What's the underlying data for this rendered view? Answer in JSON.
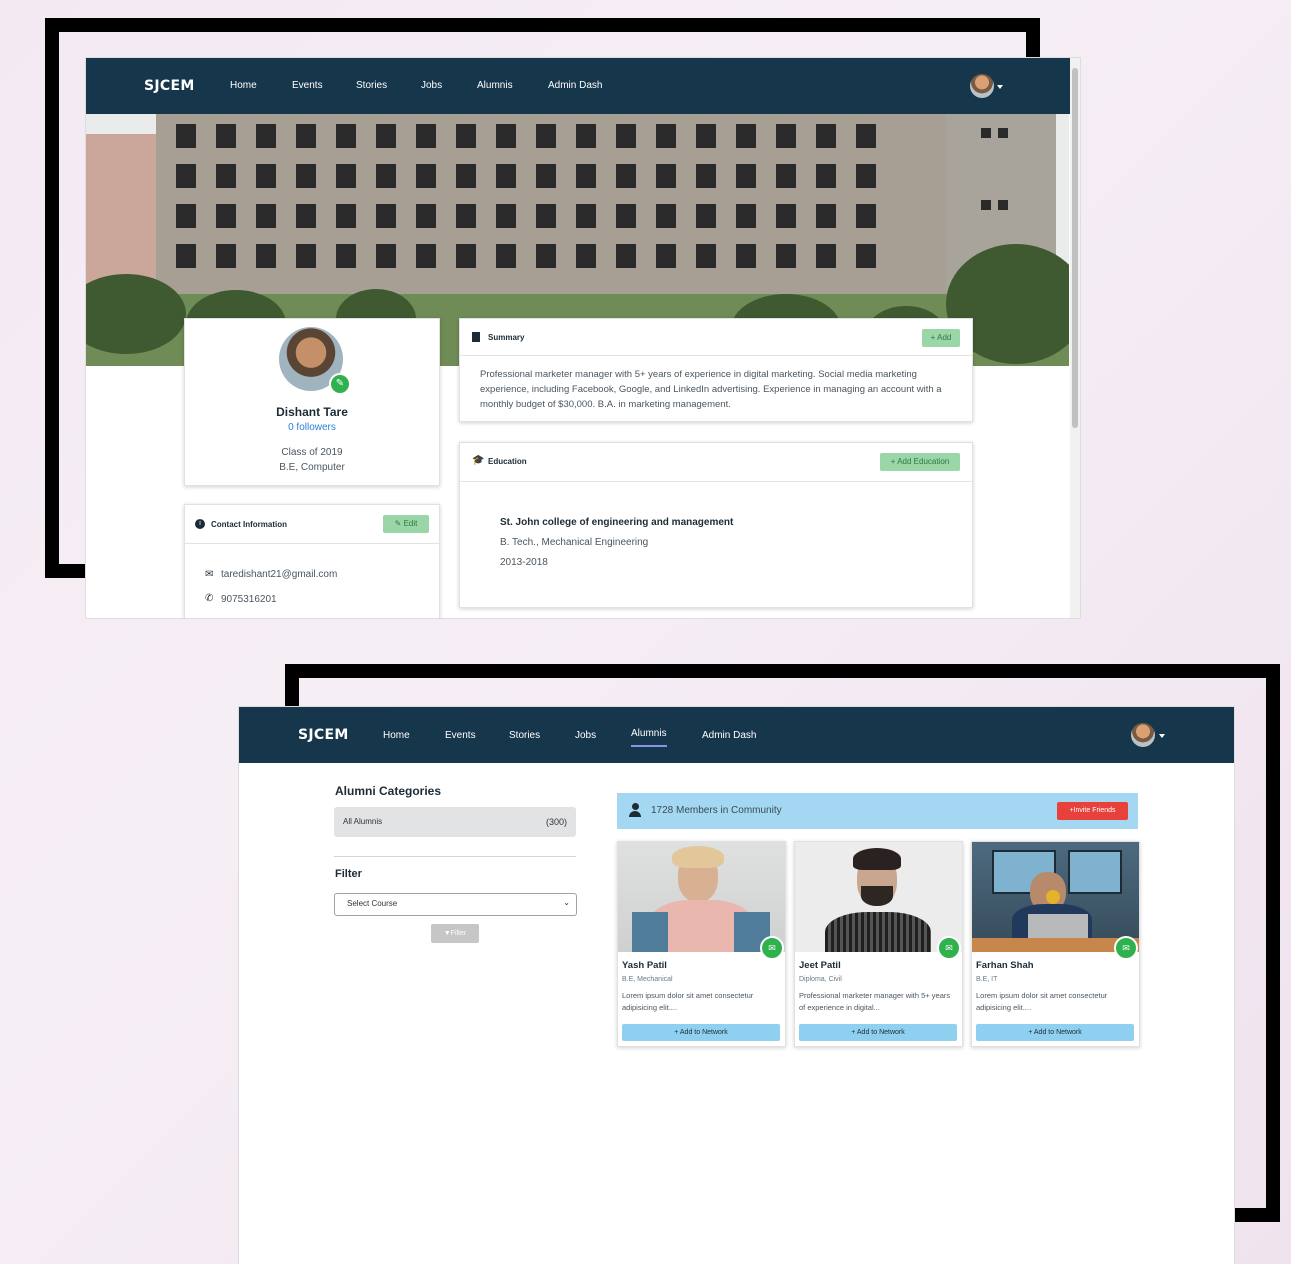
{
  "profile_page": {
    "nav": {
      "brand": "SJCEM",
      "links": [
        "Home",
        "Events",
        "Stories",
        "Jobs",
        "Alumnis",
        "Admin Dash"
      ]
    },
    "profile": {
      "name": "Dishant Tare",
      "followers": "0 followers",
      "class": "Class of 2019",
      "degree": "B.E, Computer"
    },
    "contact": {
      "title": "Contact Information",
      "edit_label": "Edit",
      "email": "taredishant21@gmail.com",
      "phone": "9075316201"
    },
    "summary": {
      "title": "Summary",
      "add_label": "+ Add",
      "text": "Professional marketer manager with 5+ years of experience in digital marketing. Social media marketing experience, including Facebook, Google, and LinkedIn advertising. Experience in managing an account with a monthly budget of $30,000. B.A. in marketing management."
    },
    "education": {
      "title": "Education",
      "add_label": "+ Add Education",
      "school": "St. John college of engineering and management",
      "course": "B. Tech., Mechanical Engineering",
      "years": "2013-2018"
    }
  },
  "alumni_page": {
    "nav": {
      "brand": "SJCEM",
      "links": [
        "Home",
        "Events",
        "Stories",
        "Jobs",
        "Alumnis",
        "Admin Dash"
      ],
      "active": "Alumnis"
    },
    "sidebar": {
      "categories_title": "Alumni Categories",
      "category_label": "All Alumnis",
      "category_count": "(300)",
      "filter_title": "Filter",
      "select_value": "Select Course",
      "filter_button": "Filter"
    },
    "community": {
      "count_text": "1728 Members in Community",
      "invite_label": "+Invite Friends"
    },
    "members": [
      {
        "name": "Yash Patil",
        "course": "B.E, Mechanical",
        "bio": "Lorem ipsum dolor sit amet consectetur adipisicing elit....",
        "action": "+ Add to Network"
      },
      {
        "name": "Jeet Patil",
        "course": "Diploma, Civil",
        "bio": "Professional marketer manager with 5+ years of experience in digital...",
        "action": "+ Add to Network"
      },
      {
        "name": "Farhan Shah",
        "course": "B.E, IT",
        "bio": "Lorem ipsum dolor sit amet consectetur adipisicing elit....",
        "action": "+ Add to Network"
      }
    ]
  },
  "colors": {
    "navbar": "#16364b",
    "accent_green": "#9ad6a8",
    "community_banner": "#a4d8f2",
    "invite_red": "#e8413c",
    "add_network": "#8fd0f0"
  }
}
